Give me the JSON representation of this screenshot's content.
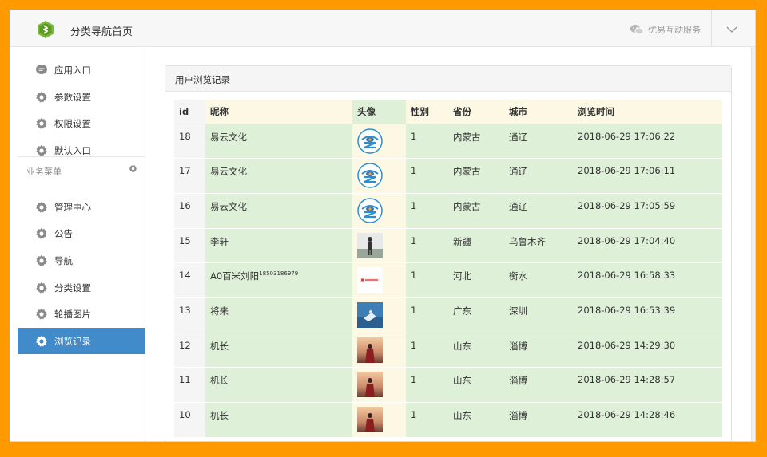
{
  "header": {
    "title": "分类导航首页",
    "service_label": "优易互动服务"
  },
  "sidebar": {
    "top_items": [
      {
        "label": "应用入口",
        "icon": "chat-icon"
      },
      {
        "label": "参数设置",
        "icon": "gear-icon"
      },
      {
        "label": "权限设置",
        "icon": "gear-icon"
      },
      {
        "label": "默认入口",
        "icon": "gear-icon"
      }
    ],
    "group_label": "业务菜单",
    "group_items": [
      {
        "label": "管理中心",
        "icon": "gear-icon"
      },
      {
        "label": "公告",
        "icon": "gear-icon"
      },
      {
        "label": "导航",
        "icon": "gear-icon"
      },
      {
        "label": "分类设置",
        "icon": "gear-icon"
      },
      {
        "label": "轮播图片",
        "icon": "gear-icon"
      },
      {
        "label": "浏览记录",
        "icon": "gear-icon",
        "active": true
      }
    ]
  },
  "panel": {
    "title": "用户浏览记录",
    "columns": [
      "id",
      "昵称",
      "头像",
      "性别",
      "省份",
      "城市",
      "浏览时间"
    ],
    "rows": [
      {
        "id": "18",
        "nickname": "易云文化",
        "nickname_sup": "",
        "avatar": "logo-avatar",
        "gender": "1",
        "province": "内蒙古",
        "city": "通辽",
        "time": "2018-06-29 17:06:22"
      },
      {
        "id": "17",
        "nickname": "易云文化",
        "nickname_sup": "",
        "avatar": "logo-avatar",
        "gender": "1",
        "province": "内蒙古",
        "city": "通辽",
        "time": "2018-06-29 17:06:11"
      },
      {
        "id": "16",
        "nickname": "易云文化",
        "nickname_sup": "",
        "avatar": "logo-avatar",
        "gender": "1",
        "province": "内蒙古",
        "city": "通辽",
        "time": "2018-06-29 17:05:59"
      },
      {
        "id": "15",
        "nickname": "李轩",
        "nickname_sup": "",
        "avatar": "person-silhouette-avatar",
        "gender": "1",
        "province": "新疆",
        "city": "乌鲁木齐",
        "time": "2018-06-29 17:04:40"
      },
      {
        "id": "14",
        "nickname": "A0百米刘阳",
        "nickname_sup": "18503186979",
        "avatar": "brand-avatar",
        "gender": "1",
        "province": "河北",
        "city": "衡水",
        "time": "2018-06-29 16:58:33"
      },
      {
        "id": "13",
        "nickname": "将来",
        "nickname_sup": "",
        "avatar": "sky-photo-avatar",
        "gender": "1",
        "province": "广东",
        "city": "深圳",
        "time": "2018-06-29 16:53:39"
      },
      {
        "id": "12",
        "nickname": "机长",
        "nickname_sup": "",
        "avatar": "sunset-person-avatar",
        "gender": "1",
        "province": "山东",
        "city": "淄博",
        "time": "2018-06-29 14:29:30"
      },
      {
        "id": "11",
        "nickname": "机长",
        "nickname_sup": "",
        "avatar": "sunset-person-avatar",
        "gender": "1",
        "province": "山东",
        "city": "淄博",
        "time": "2018-06-29 14:28:57"
      },
      {
        "id": "10",
        "nickname": "机长",
        "nickname_sup": "",
        "avatar": "sunset-person-avatar",
        "gender": "1",
        "province": "山东",
        "city": "淄博",
        "time": "2018-06-29 14:28:46"
      }
    ]
  },
  "colors": {
    "accent": "#428bca",
    "row_green": "#dff0d8",
    "row_yellow": "#fcf8e3",
    "frame": "#ff9900"
  }
}
